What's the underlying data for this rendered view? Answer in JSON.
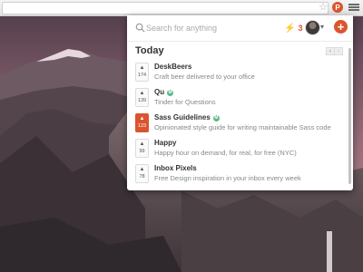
{
  "browser": {
    "extension_badge": "P",
    "star_icon": "star-icon",
    "menu_icon": "hamburger-menu-icon"
  },
  "popup": {
    "search": {
      "placeholder": "Search for anything"
    },
    "notifications": {
      "count": "3",
      "icon": "lightning-bolt-icon"
    },
    "add_button": "+",
    "section_title": "Today",
    "pager": {
      "prev": "‹",
      "next": "›"
    },
    "items": [
      {
        "title": "DeskBeers",
        "tagline": "Craft beer delivered to your office",
        "votes": "174",
        "maker_tag": "",
        "highlighted": false
      },
      {
        "title": "Qu",
        "tagline": "Tinder for Questions",
        "votes": "139",
        "maker_tag": "M",
        "highlighted": false
      },
      {
        "title": "Sass Guidelines",
        "tagline": "Opinionated style guide for writing maintainable Sass code",
        "votes": "123",
        "maker_tag": "M",
        "highlighted": true
      },
      {
        "title": "Happy",
        "tagline": "Happy hour on demand, for real, for free (NYC)",
        "votes": "99",
        "maker_tag": "",
        "highlighted": false
      },
      {
        "title": "Inbox Pixels",
        "tagline": "Free Design inspiration in your inbox every week",
        "votes": "78",
        "maker_tag": "",
        "highlighted": false
      }
    ]
  },
  "colors": {
    "accent": "#da552f",
    "maker_badge": "#5bb88a"
  }
}
